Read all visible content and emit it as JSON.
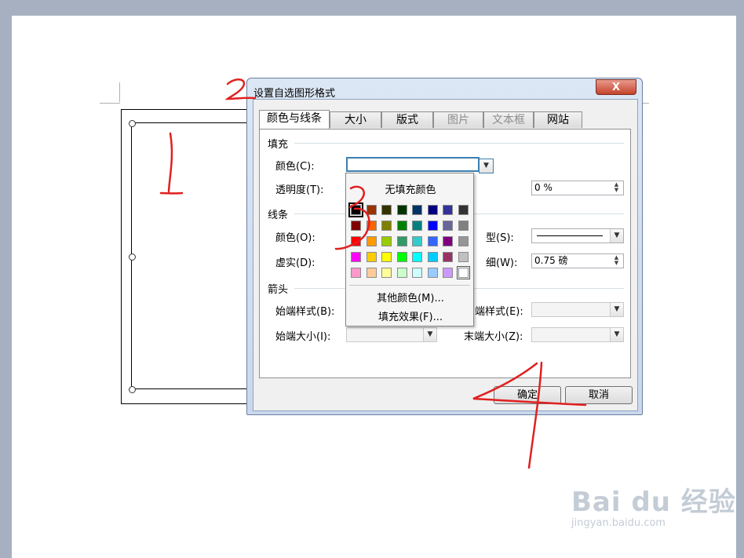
{
  "dialog": {
    "title": "设置自选图形格式",
    "close_label": "X",
    "tabs": [
      {
        "label": "颜色与线条",
        "state": "active"
      },
      {
        "label": "大小",
        "state": "normal"
      },
      {
        "label": "版式",
        "state": "normal"
      },
      {
        "label": "图片",
        "state": "disabled"
      },
      {
        "label": "文本框",
        "state": "disabled"
      },
      {
        "label": "网站",
        "state": "normal"
      }
    ],
    "fill": {
      "section_label": "填充",
      "color_label": "颜色(C):",
      "color_value": "",
      "transparency_label": "透明度(T):",
      "transparency_value": "0 %"
    },
    "line": {
      "section_label": "线条",
      "color_label": "颜色(O):",
      "dash_label": "虚实(D):",
      "style_label": "型(S):",
      "weight_label": "细(W):",
      "weight_value": "0.75 磅"
    },
    "arrows": {
      "section_label": "箭头",
      "begin_style_label": "始端样式(B):",
      "end_style_label": "端样式(E):",
      "begin_size_label": "始端大小(I):",
      "end_size_label": "末端大小(Z):"
    },
    "ok_label": "确定",
    "cancel_label": "取消"
  },
  "color_popup": {
    "no_fill_label": "无填充颜色",
    "more_colors_label": "其他颜色(M)...",
    "fill_effects_label": "填充效果(F)...",
    "palette": [
      [
        "#000000",
        "#993300",
        "#333300",
        "#003300",
        "#003366",
        "#000080",
        "#333399",
        "#333333"
      ],
      [
        "#800000",
        "#FF6600",
        "#808000",
        "#008000",
        "#008080",
        "#0000FF",
        "#666699",
        "#808080"
      ],
      [
        "#FF0000",
        "#FF9900",
        "#99CC00",
        "#339966",
        "#33CCCC",
        "#3366FF",
        "#800080",
        "#969696"
      ],
      [
        "#FF00FF",
        "#FFCC00",
        "#FFFF00",
        "#00FF00",
        "#00FFFF",
        "#00CCFF",
        "#993366",
        "#C0C0C0"
      ],
      [
        "#FF99CC",
        "#FFCC99",
        "#FFFF99",
        "#CCFFCC",
        "#CCFFFF",
        "#99CCFF",
        "#CC99FF",
        "#FFFFFF"
      ]
    ],
    "selected_swatch": "#000000"
  },
  "annotations": {
    "numbers": [
      "1",
      "2",
      "3",
      "4"
    ],
    "color": "#e02020"
  },
  "watermark": {
    "logo": "Bai du 经验",
    "url": "jingyan.baidu.com"
  }
}
